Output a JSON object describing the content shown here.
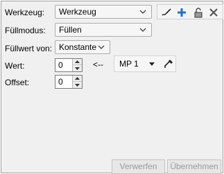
{
  "form": {
    "werkzeug": {
      "label": "Werkzeug:",
      "value": "Werkzeug"
    },
    "fuellmodus": {
      "label": "Füllmodus:",
      "value": "Füllen"
    },
    "fuellwert_von": {
      "label": "Füllwert von:",
      "value": "Konstante"
    },
    "wert": {
      "label": "Wert:",
      "value": "0"
    },
    "offset": {
      "label": "Offset:",
      "value": "0"
    },
    "arrow_text": "<--",
    "mp_select": {
      "value": "MP 1"
    }
  },
  "toolbar": {
    "icons": [
      "brush-icon",
      "plus-icon",
      "lock-icon",
      "close-icon"
    ]
  },
  "buttons": {
    "verwerfen": "Verwerfen",
    "uebernehmen": "Übernehmen"
  },
  "colors": {
    "plus": "#1e6fd0",
    "disabled_text": "#9a9a9a",
    "panel_bg": "#f0f0f0"
  }
}
